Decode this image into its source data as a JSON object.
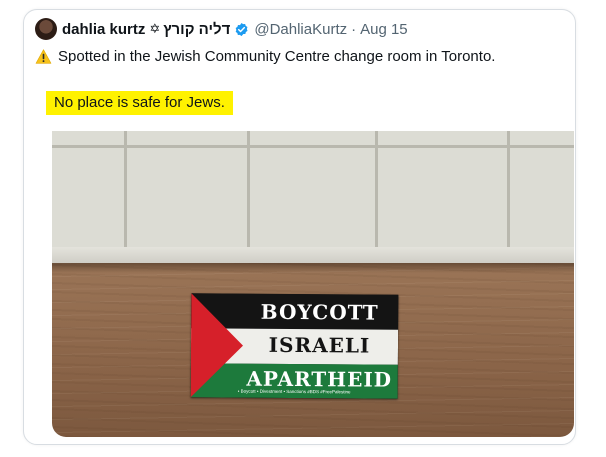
{
  "tweet": {
    "display_name": "dahlia kurtz",
    "star_glyph": "✡",
    "hebrew_name": "דליה קורץ",
    "handle": "@DahliaKurtz",
    "separator": "·",
    "date": "Aug 15",
    "text_line1": "Spotted in the Jewish Community Centre change room in Toronto.",
    "text_line2": "No place is safe for Jews.",
    "icons": [
      "avatar",
      "verified-badge-icon",
      "warning-icon"
    ],
    "colors": {
      "verified_blue": "#1d9bf0",
      "highlight": "#fff200",
      "warning_yellow": "#f7c21b",
      "secondary_text": "#536471"
    }
  },
  "photo": {
    "sticker": {
      "line1": "BOYCOTT",
      "line2": "ISRAELI",
      "line3": "APARTHEID",
      "small_text": "• Boycott • Divestment • Sanctions #BDS #FreePalestine",
      "colors": {
        "black": "#141414",
        "white": "#eeeeea",
        "green": "#1d7a3c",
        "red": "#d6202a"
      }
    }
  }
}
